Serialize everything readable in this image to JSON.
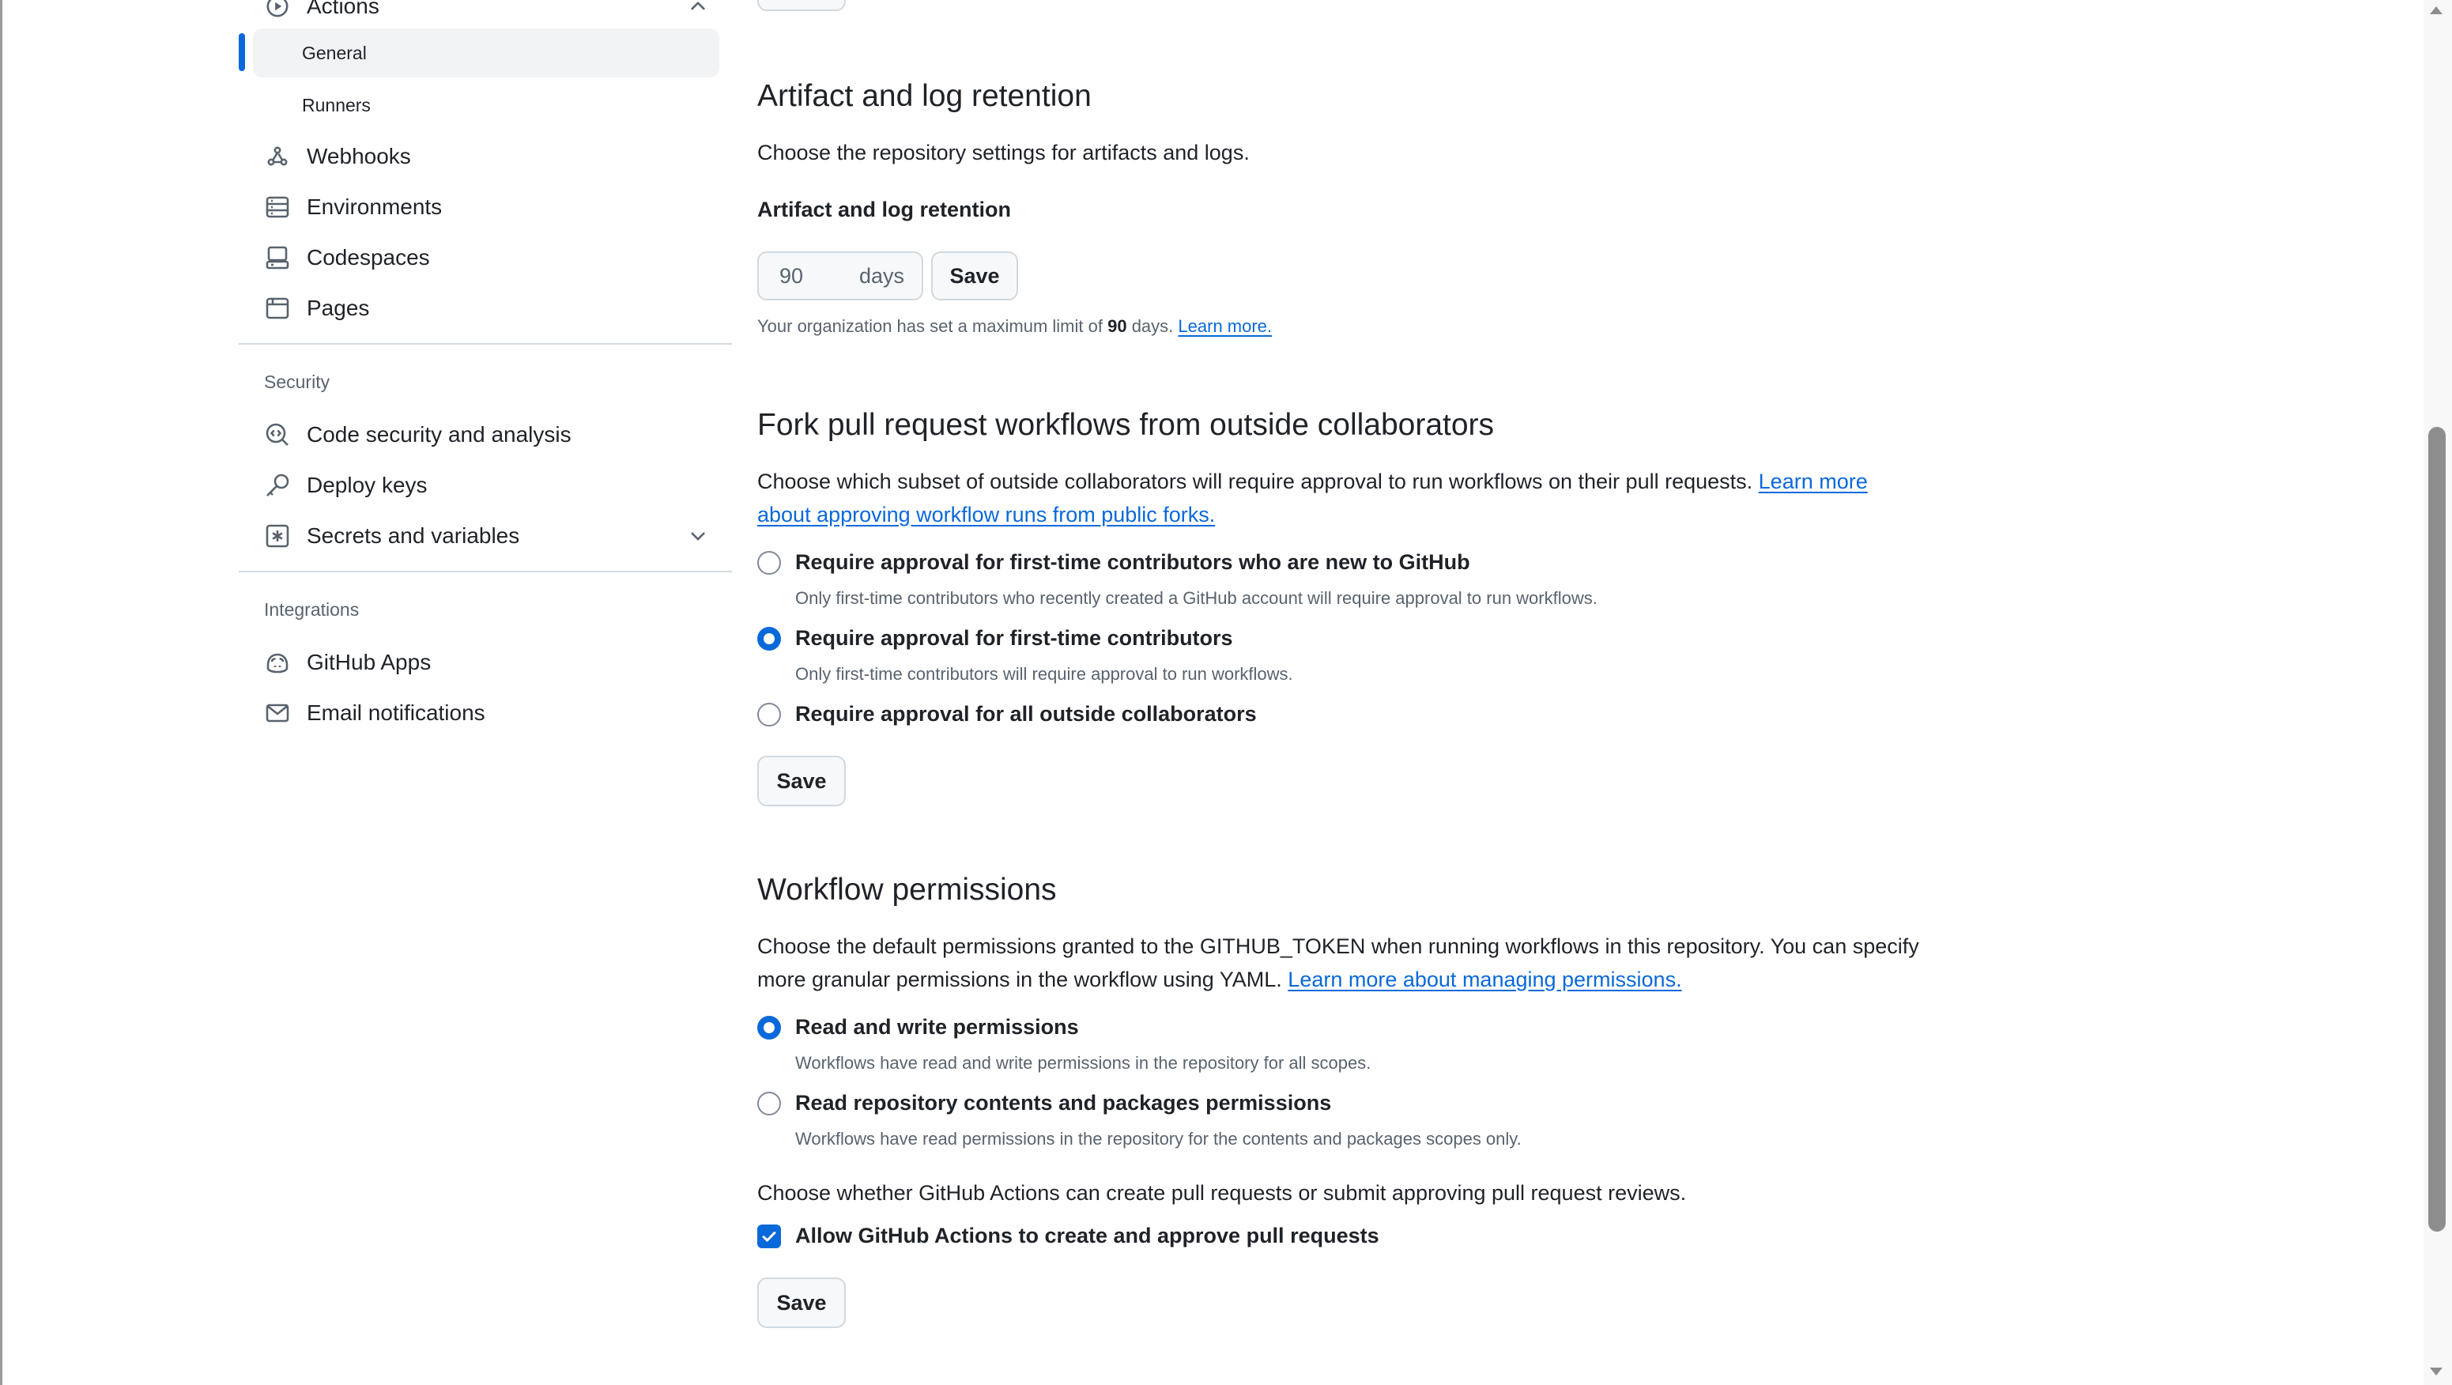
{
  "sidebar": {
    "actions_label": "Actions",
    "sub_items": [
      "General",
      "Runners"
    ],
    "items_top": [
      {
        "label": "Webhooks",
        "icon": "webhook-icon"
      },
      {
        "label": "Environments",
        "icon": "server-icon"
      },
      {
        "label": "Codespaces",
        "icon": "codespaces-icon"
      },
      {
        "label": "Pages",
        "icon": "browser-icon"
      }
    ],
    "security_heading": "Security",
    "security_items": [
      {
        "label": "Code security and analysis",
        "icon": "codescan-icon"
      },
      {
        "label": "Deploy keys",
        "icon": "key-icon"
      },
      {
        "label": "Secrets and variables",
        "icon": "asterisk-icon"
      }
    ],
    "integrations_heading": "Integrations",
    "integration_items": [
      {
        "label": "GitHub Apps",
        "icon": "copilot-icon"
      },
      {
        "label": "Email notifications",
        "icon": "mail-icon"
      }
    ]
  },
  "artifact": {
    "title": "Artifact and log retention",
    "description": "Choose the repository settings for artifacts and logs.",
    "field_label": "Artifact and log retention",
    "days_value": "90",
    "days_unit": "days",
    "save_label": "Save",
    "note_prefix": "Your organization has set a maximum limit of",
    "note_value": "90",
    "note_suffix": "days.",
    "learn_more": "Learn more."
  },
  "fork": {
    "title": "Fork pull request workflows from outside collaborators",
    "description_prefix": "Choose which subset of outside collaborators will require approval to run workflows on their pull requests.",
    "description_link_1": "Learn more",
    "description_link_2": "about approving workflow runs from public forks.",
    "options": [
      {
        "label": "Require approval for first-time contributors who are new to GitHub",
        "hint": "Only first-time contributors who recently created a GitHub account will require approval to run workflows.",
        "checked": false
      },
      {
        "label": "Require approval for first-time contributors",
        "hint": "Only first-time contributors will require approval to run workflows.",
        "checked": true
      },
      {
        "label": "Require approval for all outside collaborators",
        "hint": "",
        "checked": false
      }
    ],
    "save_label": "Save"
  },
  "workflow": {
    "title": "Workflow permissions",
    "description_line1": "Choose the default permissions granted to the GITHUB_TOKEN when running workflows in this repository. You can specify",
    "description_line2": "more granular permissions in the workflow using YAML.",
    "description_link": "Learn more about managing permissions.",
    "options": [
      {
        "label": "Read and write permissions",
        "hint": "Workflows have read and write permissions in the repository for all scopes.",
        "checked": true
      },
      {
        "label": "Read repository contents and packages permissions",
        "hint": "Workflows have read permissions in the repository for the contents and packages scopes only.",
        "checked": false
      }
    ],
    "pr_prompt": "Choose whether GitHub Actions can create pull requests or submit approving pull request reviews.",
    "pr_checkbox_label": "Allow GitHub Actions to create and approve pull requests",
    "pr_checkbox_checked": true,
    "save_label": "Save"
  },
  "colors": {
    "accent": "#0969da",
    "text": "#1f2328",
    "muted": "#59636e",
    "border": "#d1d9e0"
  }
}
